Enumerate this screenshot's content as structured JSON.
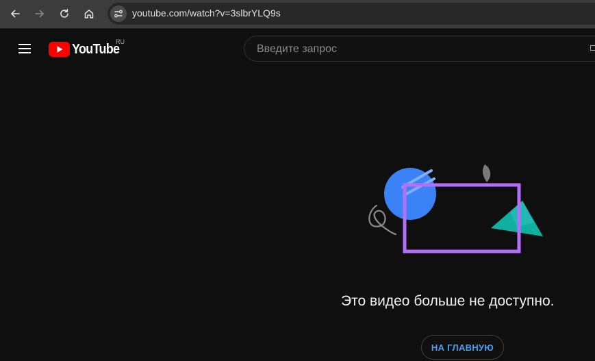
{
  "browser": {
    "url": "youtube.com/watch?v=3slbrYLQ9s",
    "icons": [
      "back-icon",
      "forward-icon",
      "reload-icon",
      "home-icon",
      "site-info-icon"
    ]
  },
  "header": {
    "logo_text": "YouTube",
    "region": "RU",
    "search_placeholder": "Введите запрос",
    "icons": [
      "menu-icon",
      "youtube-logo-icon",
      "keyboard-icon"
    ]
  },
  "main": {
    "error_message": "Это видео больше не доступно.",
    "home_button_label": "НА ГЛАВНУЮ",
    "illustration": "video-unavailable-illustration"
  },
  "colors": {
    "background": "#0f0f0f",
    "browser_bar": "#3c3c3c",
    "brand_red": "#ff0000",
    "link_blue": "#3ea6ff",
    "illustration_circle": "#3b82f6",
    "illustration_frame": "#b46efa",
    "illustration_triangle": "#10b0a0"
  }
}
